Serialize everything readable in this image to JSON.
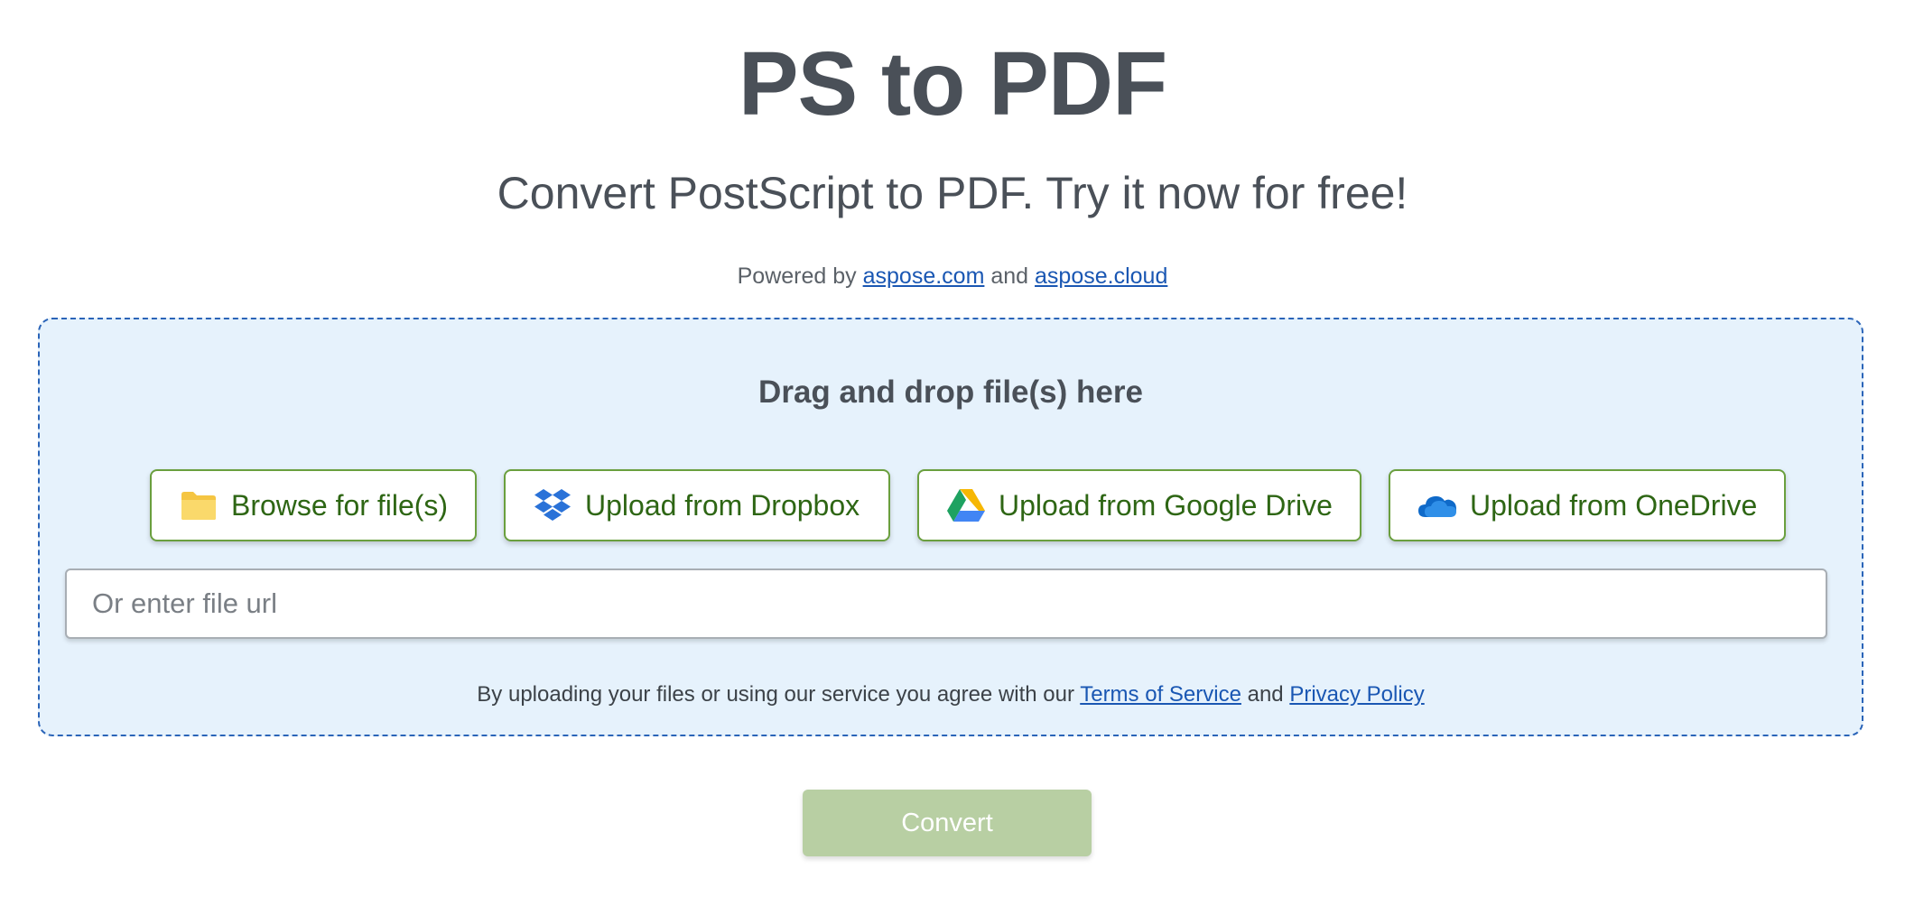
{
  "header": {
    "title": "PS to PDF",
    "subtitle": "Convert PostScript to PDF. Try it now for free!",
    "powered_prefix": "Powered by",
    "powered_link1": "aspose.com",
    "powered_and": "and",
    "powered_link2": "aspose.cloud"
  },
  "dropzone": {
    "label": "Drag and drop file(s) here",
    "buttons": [
      {
        "label": "Browse for file(s)",
        "icon": "folder-icon"
      },
      {
        "label": "Upload from Dropbox",
        "icon": "dropbox-icon"
      },
      {
        "label": "Upload from Google Drive",
        "icon": "google-drive-icon"
      },
      {
        "label": "Upload from OneDrive",
        "icon": "onedrive-icon"
      }
    ],
    "url_placeholder": "Or enter file url",
    "url_value": "",
    "terms_prefix": "By uploading your files or using our service you agree with our",
    "terms_link": "Terms of Service",
    "terms_and": "and",
    "privacy_link": "Privacy Policy"
  },
  "actions": {
    "convert_label": "Convert",
    "convert_enabled": false
  },
  "colors": {
    "accent_green": "#2e6614",
    "button_border": "#6a9f3e",
    "dropzone_bg": "#e6f2fc",
    "dropzone_border": "#2a64b8",
    "link": "#1a57b3",
    "convert_disabled": "#b8cfa3"
  }
}
